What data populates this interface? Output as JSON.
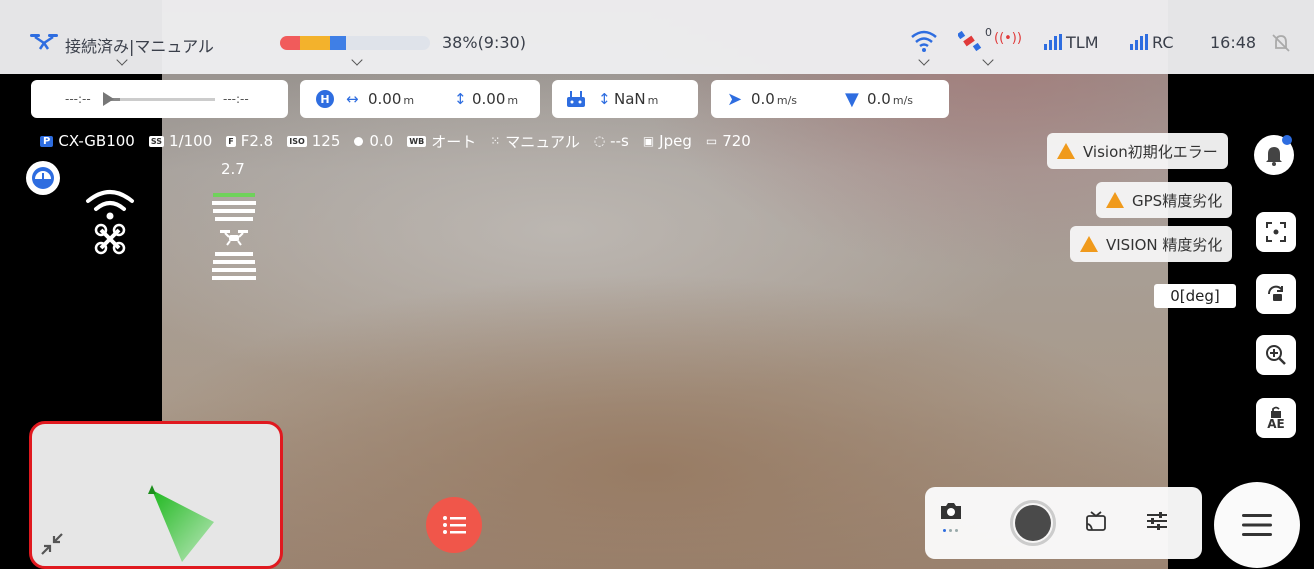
{
  "status_bar": {
    "connection_label": "接続済み|マニュアル",
    "battery_text": "38%(9:30)",
    "satellite_count": "0",
    "tlm_label": "TLM",
    "rc_label": "RC",
    "time": "16:48"
  },
  "telemetry": {
    "timeline_left": "---:--",
    "timeline_right": "---:--",
    "home_distance": "0.00",
    "home_distance_unit": "m",
    "altitude": "0.00",
    "altitude_unit": "m",
    "rc_altitude": "NaN",
    "rc_altitude_unit": "m",
    "horizontal_speed": "0.0",
    "horizontal_speed_unit": "m/s",
    "vertical_speed": "0.0",
    "vertical_speed_unit": "m/s"
  },
  "camera_params": {
    "model": "CX-GB100",
    "shutter": "1/100",
    "aperture": "F2.8",
    "iso": "125",
    "ev": "0.0",
    "white_balance": "オート",
    "focus_mode": "マニュアル",
    "interval": "--s",
    "format": "Jpeg",
    "resolution": "720",
    "tag_p": "P",
    "tag_ss": "SS",
    "tag_f": "F",
    "tag_iso": "ISO",
    "tag_wb": "WB"
  },
  "obstacle": {
    "distance": "2.7"
  },
  "warnings": [
    {
      "text": "Vision初期化エラー"
    },
    {
      "text": "GPS精度劣化"
    },
    {
      "text": "VISION 精度劣化"
    }
  ],
  "gimbal": {
    "angle": "0[deg]"
  },
  "ae_label": "AE",
  "colors": {
    "accent": "#2e6de0",
    "warning": "#f09a1c",
    "menu_button": "#f0564a",
    "map_border": "#e0191f",
    "battery_red": "#f15b5b",
    "battery_yellow": "#f3b22c",
    "battery_blue": "#3f7fe6"
  }
}
